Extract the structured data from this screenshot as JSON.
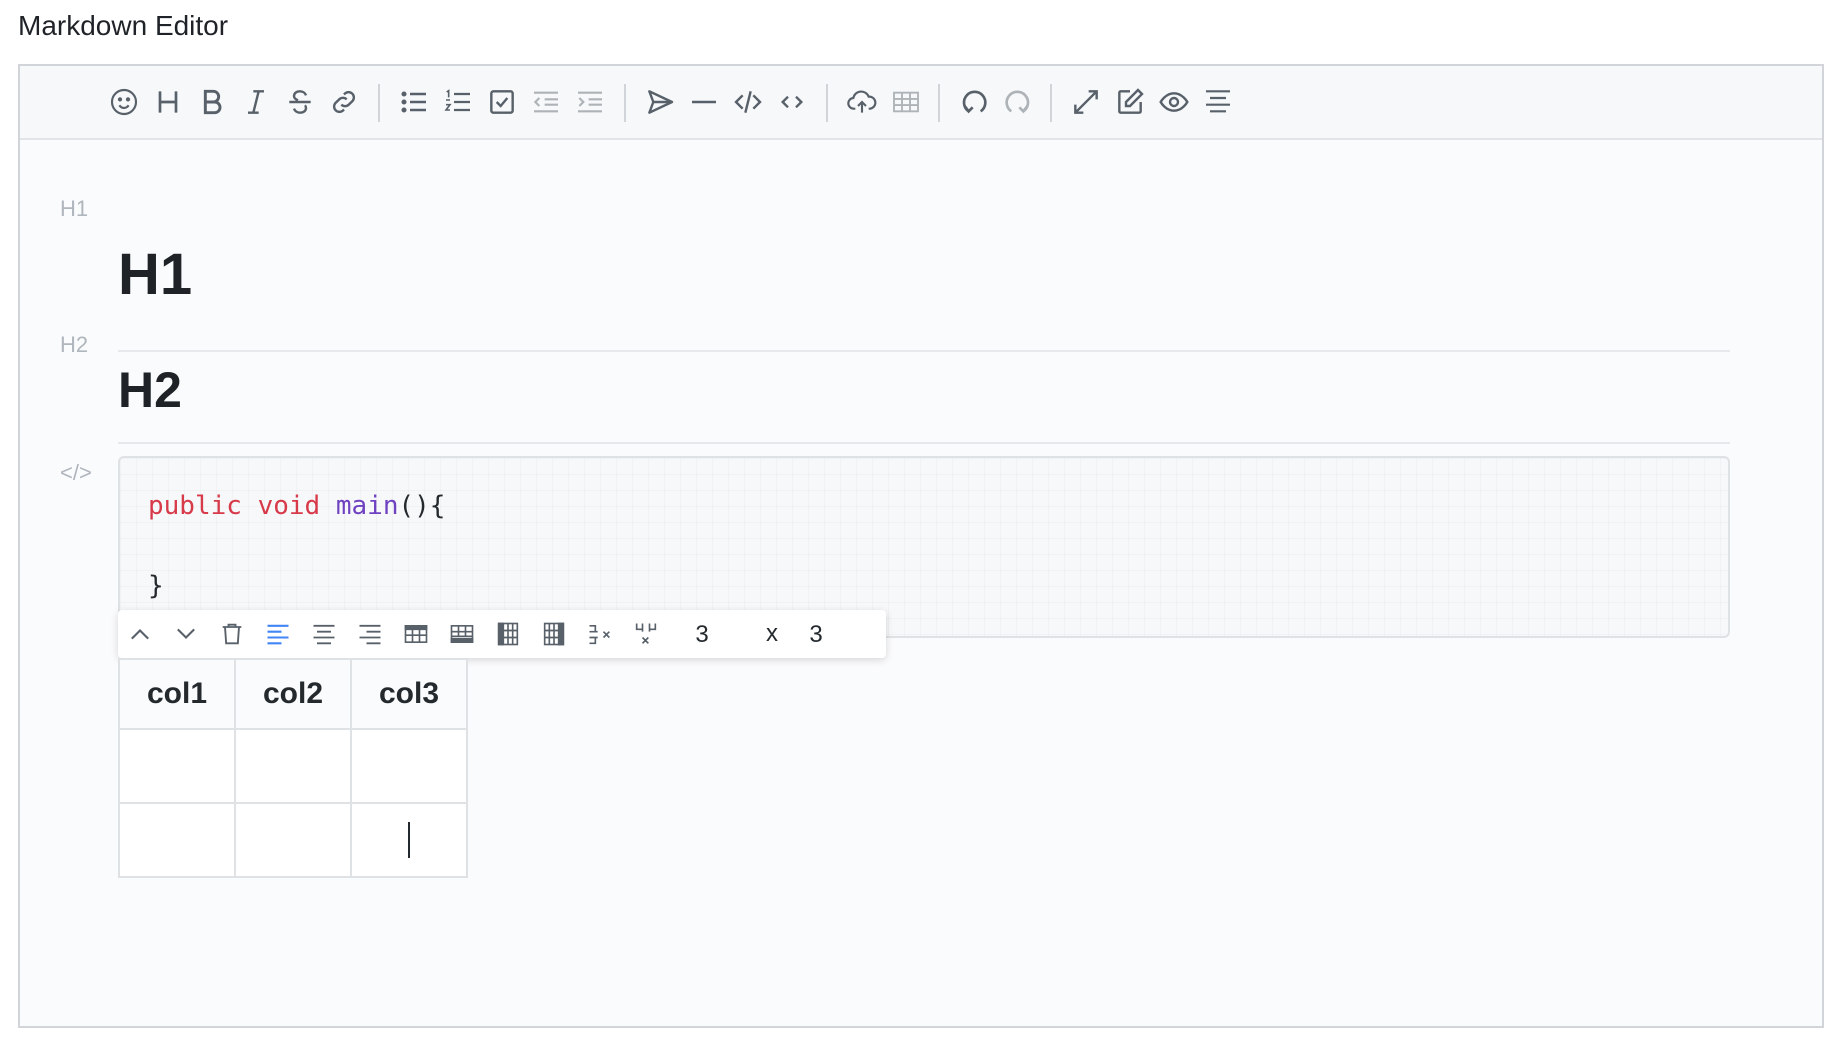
{
  "page": {
    "title": "Markdown Editor"
  },
  "toolbar": {
    "buttons": [
      {
        "name": "emoji-icon"
      },
      {
        "name": "heading-icon"
      },
      {
        "name": "bold-icon"
      },
      {
        "name": "italic-icon"
      },
      {
        "name": "strikethrough-icon"
      },
      {
        "name": "link-icon"
      },
      {
        "name": "bullet-list-icon"
      },
      {
        "name": "ordered-list-icon"
      },
      {
        "name": "checklist-icon"
      },
      {
        "name": "outdent-icon",
        "disabled": true
      },
      {
        "name": "indent-icon",
        "disabled": true
      },
      {
        "name": "quote-icon"
      },
      {
        "name": "horizontal-rule-icon"
      },
      {
        "name": "code-block-icon"
      },
      {
        "name": "inline-code-icon"
      },
      {
        "name": "upload-icon"
      },
      {
        "name": "table-icon",
        "disabled": true
      },
      {
        "name": "undo-icon"
      },
      {
        "name": "redo-icon",
        "disabled": true
      },
      {
        "name": "fullscreen-icon"
      },
      {
        "name": "edit-mode-icon"
      },
      {
        "name": "preview-icon"
      },
      {
        "name": "outline-icon"
      }
    ]
  },
  "content": {
    "h1": {
      "marker": "H1",
      "text": "H1"
    },
    "h2": {
      "marker": "H2",
      "text": "H2"
    },
    "code": {
      "marker": "</>",
      "line1": {
        "kw1": "public",
        "kw2": "void",
        "fn": "main",
        "rest": "(){"
      },
      "line3": "}"
    },
    "table_toolbar": {
      "rows": "3",
      "times": "x",
      "cols": "3",
      "active_color": "#4285f4"
    },
    "table": {
      "headers": [
        "col1",
        "col2",
        "col3"
      ]
    }
  },
  "colors": {
    "keyword": "#d73a49",
    "function": "#6f42c1",
    "icon": "#586069"
  }
}
